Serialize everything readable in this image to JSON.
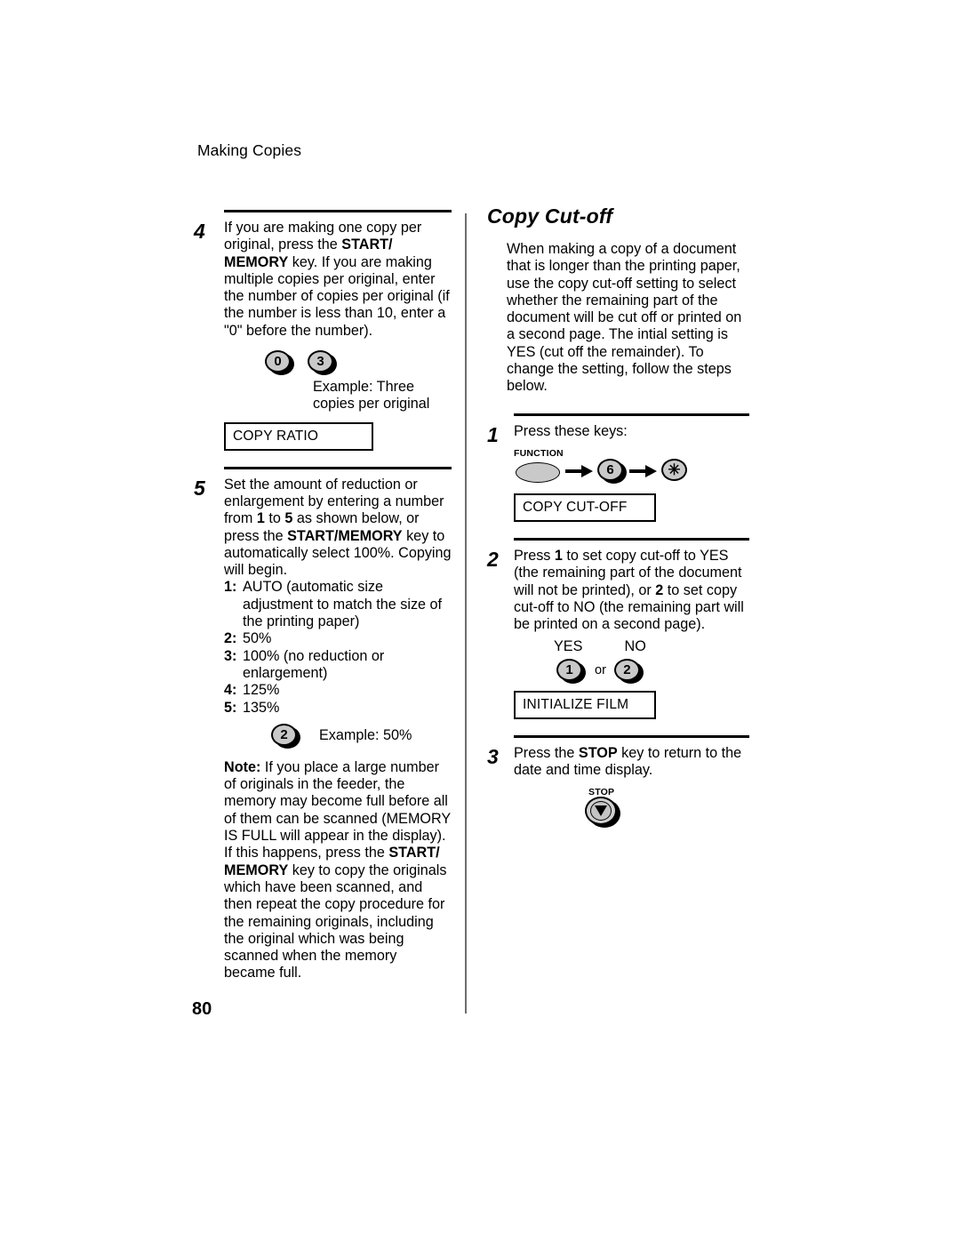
{
  "document": {
    "running_header": "Making Copies",
    "page_number": "80"
  },
  "left_column": {
    "step4": {
      "number": "4",
      "text_part1": "If you are making one copy per original, press the ",
      "bold1": "START/ MEMORY",
      "text_part2": " key. If you are making multiple copies per original, enter the number of copies per original (if the number is less than 10, enter a \"0\" before the number).",
      "keys": [
        {
          "label": "0",
          "name": "key-0"
        },
        {
          "label": "3",
          "name": "key-3"
        }
      ],
      "example_line1": "Example: Three",
      "example_line2": "copies per original",
      "lcd": "COPY RATIO"
    },
    "step5": {
      "number": "5",
      "text_part1": "Set the amount of reduction or enlargement by entering a number from ",
      "bold_1": "1",
      "text_mid1": " to ",
      "bold_5": "5",
      "text_mid2": " as shown below, or press the ",
      "bold_start": "START/MEMORY",
      "text_part2": " key to automatically select 100%. Copying will begin.",
      "options": [
        {
          "label": "1:",
          "text": "AUTO (automatic size adjustment to match the size of the printing paper)"
        },
        {
          "label": "2:",
          "text": "50%"
        },
        {
          "label": "3:",
          "text": "100% (no reduction or enlargement)"
        },
        {
          "label": "4:",
          "text": "125%"
        },
        {
          "label": "5:",
          "text": "135%"
        }
      ],
      "example_key": "2",
      "example_text": "Example: 50%",
      "note_label": "Note:",
      "note_part1": " If you place a large number of originals in the feeder, the memory may become full before all of them can be scanned (MEMORY IS FULL will appear in the display). If this happens, press the ",
      "note_bold": "START/ MEMORY",
      "note_part2": " key to copy the originals which have been scanned, and then repeat the copy procedure for the remaining originals, including the original which was being scanned when the memory became full."
    }
  },
  "right_column": {
    "title": "Copy Cut-off",
    "intro": "When making a copy of a document that is longer than the printing paper, use the copy cut-off setting to select whether the remaining part of the document will be cut off or printed on a second page. The intial setting is YES (cut off the remainder). To change the setting, follow the steps below.",
    "step1": {
      "number": "1",
      "text": "Press these keys:",
      "function_key_label": "FUNCTION",
      "key_6": "6",
      "key_star": "✳",
      "lcd": "COPY CUT-OFF"
    },
    "step2": {
      "number": "2",
      "text_part1": "Press ",
      "bold_1": "1",
      "text_part2": " to set copy cut-off to YES (the remaining part of the document will not be printed), or ",
      "bold_2": "2",
      "text_part3": " to set copy cut-off to NO (the remaining part will be printed on a second page).",
      "yes_label": "YES",
      "no_label": "NO",
      "key_yes": "1",
      "or_label": "or",
      "key_no": "2",
      "lcd": "INITIALIZE FILM"
    },
    "step3": {
      "number": "3",
      "text_part1": "Press the ",
      "bold_stop": "STOP",
      "text_part2": " key to return to the date and time display.",
      "stop_key_label": "STOP"
    }
  },
  "colors": {
    "key_face": "#c9c9c9",
    "key_outline": "#000000",
    "divider": "#6d6d6d",
    "text": "#000000"
  }
}
